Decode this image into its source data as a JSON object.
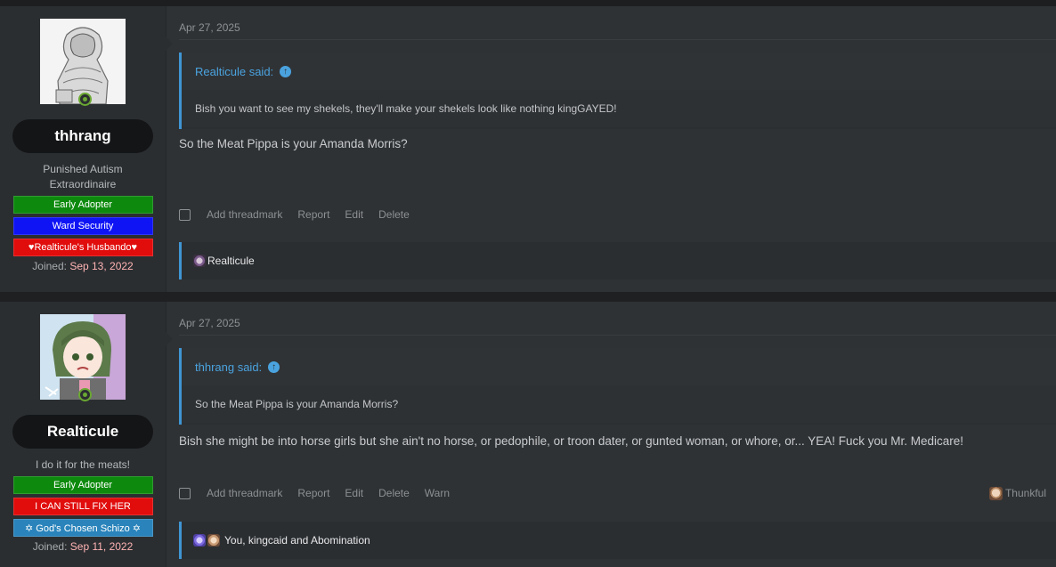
{
  "posts": [
    {
      "user": {
        "name": "thhrang",
        "title": "Punished Autism Extraordinaire",
        "banners": [
          "Early Adopter",
          "Ward Security",
          "♥Realticule's Husbando♥"
        ],
        "joined_label": "Joined:",
        "joined_date": "Sep 13, 2022"
      },
      "date": "Apr 27, 2025",
      "quote": {
        "author": "Realticule said:",
        "text": "Bish you want to see my shekels, they'll make your shekels look like nothing kingGAYED!"
      },
      "message": "So the Meat Pippa is your Amanda Morris?",
      "actions": [
        "Add threadmark",
        "Report",
        "Edit",
        "Delete"
      ],
      "reactions": "Realticule"
    },
    {
      "user": {
        "name": "Realticule",
        "title": "I do it for the meats!",
        "banners": [
          "Early Adopter",
          "I CAN STILL FIX HER",
          "✡ God's Chosen Schizo ✡"
        ],
        "joined_label": "Joined:",
        "joined_date": "Sep 11, 2022"
      },
      "date": "Apr 27, 2025",
      "quote": {
        "author": "thhrang said:",
        "text": "So the Meat Pippa is your Amanda Morris?"
      },
      "message": "Bish she might be into horse girls but she ain't no horse, or pedophile, or troon dater, or gunted woman, or whore, or... YEA! Fuck you Mr. Medicare!",
      "actions": [
        "Add threadmark",
        "Report",
        "Edit",
        "Delete",
        "Warn"
      ],
      "react_button": "Thunkful",
      "reactions": "You, kingcaid and Abomination"
    }
  ],
  "colors": {
    "accent": "#3f95d2",
    "joined_date": "#ffb4b4",
    "online": "#6aa832"
  }
}
